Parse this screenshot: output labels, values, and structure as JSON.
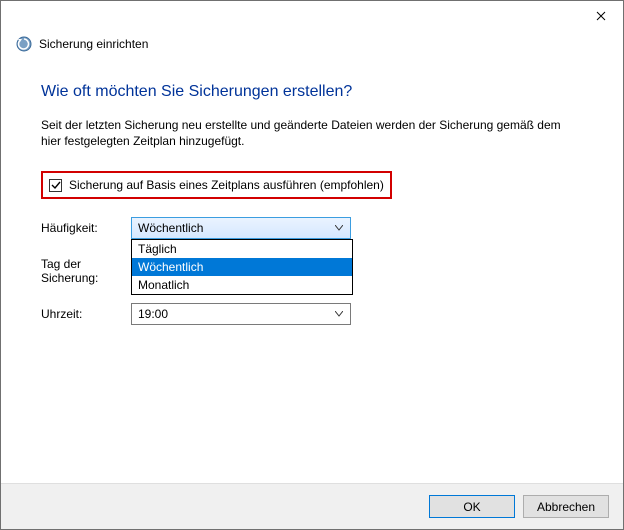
{
  "window": {
    "title": "Sicherung einrichten"
  },
  "page": {
    "heading": "Wie oft möchten Sie Sicherungen erstellen?",
    "description": "Seit der letzten Sicherung neu erstellte und geänderte Dateien werden der Sicherung gemäß dem hier festgelegten Zeitplan hinzugefügt."
  },
  "checkbox": {
    "label": "Sicherung auf Basis eines Zeitplans ausführen (empfohlen)",
    "checked": true
  },
  "form": {
    "frequency": {
      "label": "Häufigkeit:",
      "value": "Wöchentlich",
      "options": [
        "Täglich",
        "Wöchentlich",
        "Monatlich"
      ],
      "open": true,
      "selected_index": 1
    },
    "day": {
      "label": "Tag der Sicherung:"
    },
    "time": {
      "label": "Uhrzeit:",
      "value": "19:00"
    }
  },
  "footer": {
    "ok": "OK",
    "cancel": "Abbrechen"
  }
}
